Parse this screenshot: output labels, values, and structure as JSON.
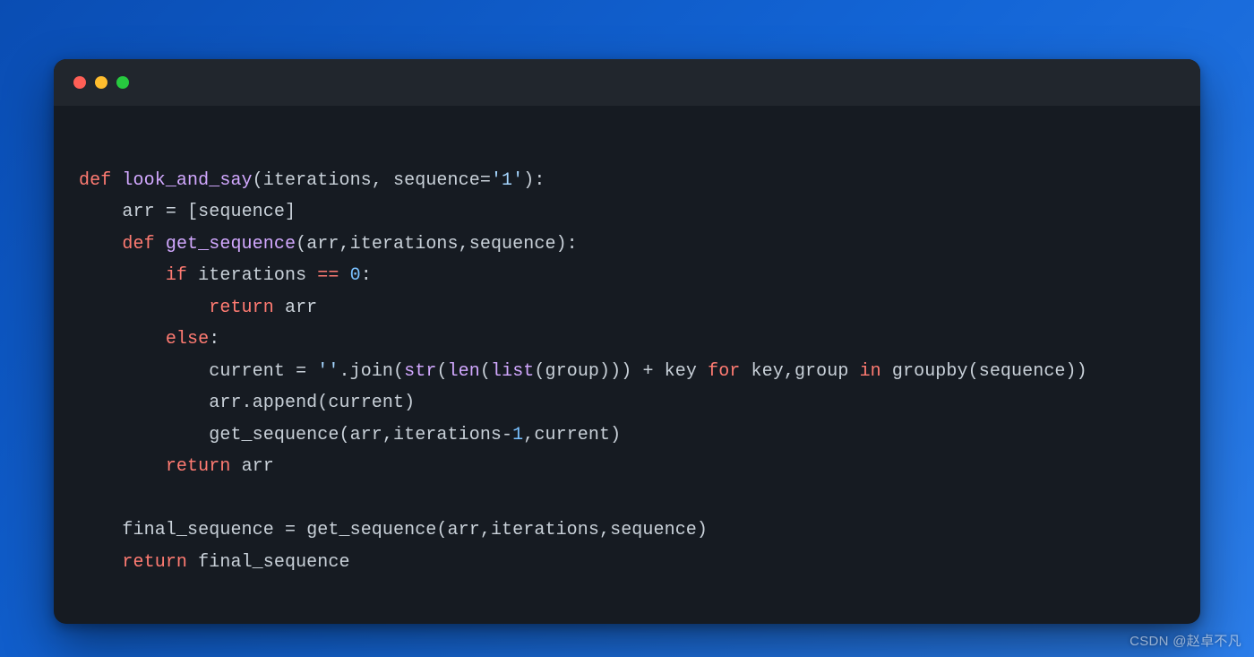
{
  "window": {
    "traffic_lights": [
      "red",
      "yellow",
      "green"
    ]
  },
  "code": {
    "language": "python",
    "tokens": [
      [],
      [
        {
          "t": "kw",
          "v": "def"
        },
        {
          "t": "sp",
          "v": " "
        },
        {
          "t": "fn",
          "v": "look_and_say"
        },
        {
          "t": "pun",
          "v": "("
        },
        {
          "t": "id",
          "v": "iterations"
        },
        {
          "t": "pun",
          "v": ", "
        },
        {
          "t": "id",
          "v": "sequence"
        },
        {
          "t": "pun",
          "v": "="
        },
        {
          "t": "str",
          "v": "'1'"
        },
        {
          "t": "pun",
          "v": "):"
        }
      ],
      [
        {
          "t": "sp",
          "v": "    "
        },
        {
          "t": "id",
          "v": "arr"
        },
        {
          "t": "sp",
          "v": " "
        },
        {
          "t": "pun",
          "v": "="
        },
        {
          "t": "sp",
          "v": " "
        },
        {
          "t": "pun",
          "v": "["
        },
        {
          "t": "id",
          "v": "sequence"
        },
        {
          "t": "pun",
          "v": "]"
        }
      ],
      [
        {
          "t": "sp",
          "v": "    "
        },
        {
          "t": "kw",
          "v": "def"
        },
        {
          "t": "sp",
          "v": " "
        },
        {
          "t": "fn",
          "v": "get_sequence"
        },
        {
          "t": "pun",
          "v": "("
        },
        {
          "t": "id",
          "v": "arr"
        },
        {
          "t": "pun",
          "v": ","
        },
        {
          "t": "id",
          "v": "iterations"
        },
        {
          "t": "pun",
          "v": ","
        },
        {
          "t": "id",
          "v": "sequence"
        },
        {
          "t": "pun",
          "v": "):"
        }
      ],
      [
        {
          "t": "sp",
          "v": "        "
        },
        {
          "t": "kw",
          "v": "if"
        },
        {
          "t": "sp",
          "v": " "
        },
        {
          "t": "id",
          "v": "iterations"
        },
        {
          "t": "sp",
          "v": " "
        },
        {
          "t": "kw",
          "v": "=="
        },
        {
          "t": "sp",
          "v": " "
        },
        {
          "t": "num",
          "v": "0"
        },
        {
          "t": "pun",
          "v": ":"
        }
      ],
      [
        {
          "t": "sp",
          "v": "            "
        },
        {
          "t": "kw",
          "v": "return"
        },
        {
          "t": "sp",
          "v": " "
        },
        {
          "t": "id",
          "v": "arr"
        }
      ],
      [
        {
          "t": "sp",
          "v": "        "
        },
        {
          "t": "kw",
          "v": "else"
        },
        {
          "t": "pun",
          "v": ":"
        }
      ],
      [
        {
          "t": "sp",
          "v": "            "
        },
        {
          "t": "id",
          "v": "current"
        },
        {
          "t": "sp",
          "v": " "
        },
        {
          "t": "pun",
          "v": "="
        },
        {
          "t": "sp",
          "v": " "
        },
        {
          "t": "str",
          "v": "''"
        },
        {
          "t": "pun",
          "v": "."
        },
        {
          "t": "id",
          "v": "join"
        },
        {
          "t": "pun",
          "v": "("
        },
        {
          "t": "call",
          "v": "str"
        },
        {
          "t": "pun",
          "v": "("
        },
        {
          "t": "call",
          "v": "len"
        },
        {
          "t": "pun",
          "v": "("
        },
        {
          "t": "call",
          "v": "list"
        },
        {
          "t": "pun",
          "v": "("
        },
        {
          "t": "id",
          "v": "group"
        },
        {
          "t": "pun",
          "v": ")))"
        },
        {
          "t": "sp",
          "v": " "
        },
        {
          "t": "pun",
          "v": "+"
        },
        {
          "t": "sp",
          "v": " "
        },
        {
          "t": "id",
          "v": "key"
        },
        {
          "t": "sp",
          "v": " "
        },
        {
          "t": "kw",
          "v": "for"
        },
        {
          "t": "sp",
          "v": " "
        },
        {
          "t": "id",
          "v": "key"
        },
        {
          "t": "pun",
          "v": ","
        },
        {
          "t": "id",
          "v": "group"
        },
        {
          "t": "sp",
          "v": " "
        },
        {
          "t": "kw",
          "v": "in"
        },
        {
          "t": "sp",
          "v": " "
        },
        {
          "t": "id",
          "v": "groupby"
        },
        {
          "t": "pun",
          "v": "("
        },
        {
          "t": "id",
          "v": "sequence"
        },
        {
          "t": "pun",
          "v": "))"
        }
      ],
      [
        {
          "t": "sp",
          "v": "            "
        },
        {
          "t": "id",
          "v": "arr"
        },
        {
          "t": "pun",
          "v": "."
        },
        {
          "t": "id",
          "v": "append"
        },
        {
          "t": "pun",
          "v": "("
        },
        {
          "t": "id",
          "v": "current"
        },
        {
          "t": "pun",
          "v": ")"
        }
      ],
      [
        {
          "t": "sp",
          "v": "            "
        },
        {
          "t": "id",
          "v": "get_sequence"
        },
        {
          "t": "pun",
          "v": "("
        },
        {
          "t": "id",
          "v": "arr"
        },
        {
          "t": "pun",
          "v": ","
        },
        {
          "t": "id",
          "v": "iterations"
        },
        {
          "t": "pun",
          "v": "-"
        },
        {
          "t": "num",
          "v": "1"
        },
        {
          "t": "pun",
          "v": ","
        },
        {
          "t": "id",
          "v": "current"
        },
        {
          "t": "pun",
          "v": ")"
        }
      ],
      [
        {
          "t": "sp",
          "v": "        "
        },
        {
          "t": "kw",
          "v": "return"
        },
        {
          "t": "sp",
          "v": " "
        },
        {
          "t": "id",
          "v": "arr"
        }
      ],
      [],
      [
        {
          "t": "sp",
          "v": "    "
        },
        {
          "t": "id",
          "v": "final_sequence"
        },
        {
          "t": "sp",
          "v": " "
        },
        {
          "t": "pun",
          "v": "="
        },
        {
          "t": "sp",
          "v": " "
        },
        {
          "t": "id",
          "v": "get_sequence"
        },
        {
          "t": "pun",
          "v": "("
        },
        {
          "t": "id",
          "v": "arr"
        },
        {
          "t": "pun",
          "v": ","
        },
        {
          "t": "id",
          "v": "iterations"
        },
        {
          "t": "pun",
          "v": ","
        },
        {
          "t": "id",
          "v": "sequence"
        },
        {
          "t": "pun",
          "v": ")"
        }
      ],
      [
        {
          "t": "sp",
          "v": "    "
        },
        {
          "t": "kw",
          "v": "return"
        },
        {
          "t": "sp",
          "v": " "
        },
        {
          "t": "id",
          "v": "final_sequence"
        }
      ]
    ]
  },
  "watermark": "CSDN @赵卓不凡"
}
